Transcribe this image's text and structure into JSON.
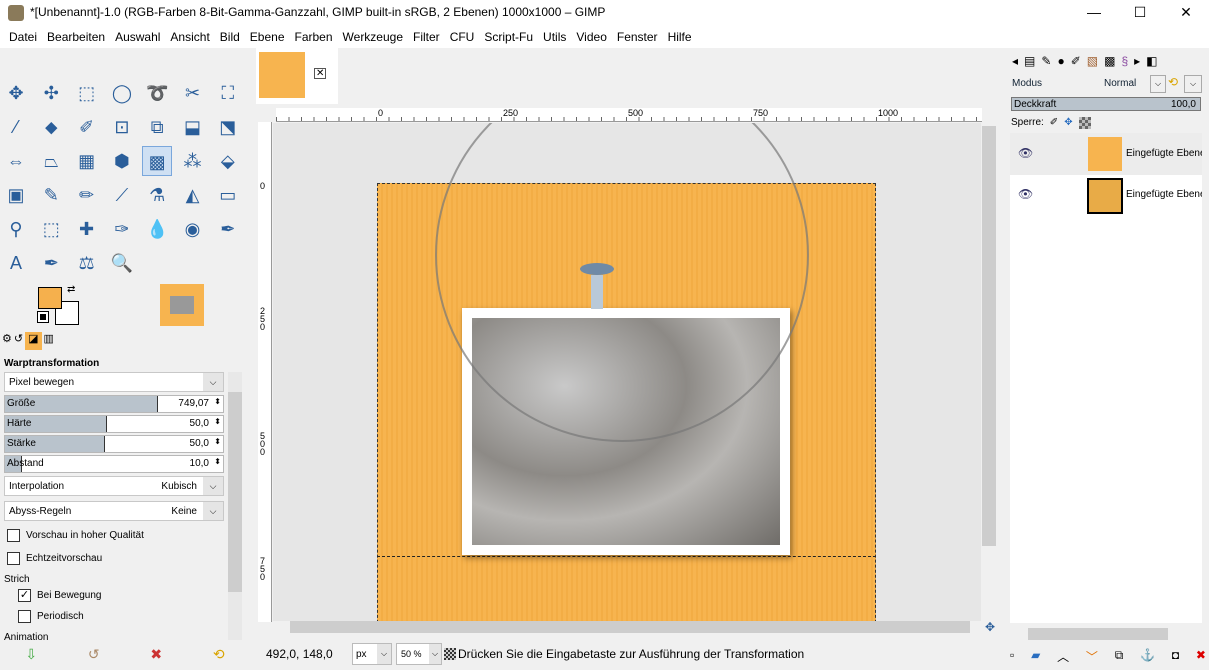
{
  "window": {
    "title": "*[Unbenannt]-1.0 (RGB-Farben 8-Bit-Gamma-Ganzzahl, GIMP built-in sRGB, 2 Ebenen) 1000x1000 – GIMP",
    "minimize": "—",
    "maximize": "☐",
    "close": "✕"
  },
  "menu": [
    "Datei",
    "Bearbeiten",
    "Auswahl",
    "Ansicht",
    "Bild",
    "Ebene",
    "Farben",
    "Werkzeuge",
    "Filter",
    "CFU",
    "Script-Fu",
    "Utils",
    "Video",
    "Fenster",
    "Hilfe"
  ],
  "tools": [
    "✥",
    "✣",
    "⬚",
    "◯",
    "➰",
    "✂",
    "⛶",
    "⁄",
    "⬥",
    "✐",
    "⊡",
    "⧉",
    "⬓",
    "⬔",
    "⇔",
    "⏢",
    "▦",
    "⬢",
    "▩",
    "⁂",
    "⬙",
    "▣",
    "✎",
    "✏",
    "⟋",
    "⚗",
    "◭",
    "▭",
    "⚲",
    "⬚",
    "✚",
    "✑",
    "💧",
    "◉",
    "✒",
    "A",
    "✒",
    "⚖",
    "🔍"
  ],
  "tool_options": {
    "title": "Warptransformation",
    "mode": "Pixel bewegen",
    "sliders": [
      {
        "label": "Größe",
        "value": "749,07",
        "fill": 0.7
      },
      {
        "label": "Härte",
        "value": "50,0",
        "fill": 0.47
      },
      {
        "label": "Stärke",
        "value": "50,0",
        "fill": 0.46
      },
      {
        "label": "Abstand",
        "value": "10,0",
        "fill": 0.08
      }
    ],
    "interpolation": {
      "label": "Interpolation",
      "value": "Kubisch"
    },
    "abyss": {
      "label": "Abyss-Regeln",
      "value": "Keine"
    },
    "checks": [
      {
        "label": "Vorschau in hoher Qualität",
        "checked": false
      },
      {
        "label": "Echtzeitvorschau",
        "checked": false
      }
    ],
    "stroke_label": "Strich",
    "stroke_checks": [
      {
        "label": "Bei Bewegung",
        "checked": true,
        "mark": "✓"
      },
      {
        "label": "Periodisch",
        "checked": false
      }
    ],
    "animation_label": "Animation"
  },
  "ruler": {
    "h": [
      "0",
      "250",
      "500",
      "750",
      "1000"
    ],
    "v": [
      "0",
      "250",
      "500",
      "750"
    ]
  },
  "status": {
    "coords": "492,0, 148,0",
    "unit": "px",
    "zoom": "50 %",
    "message": "Drücken Sie die Eingabetaste zur Ausführung der Transformation"
  },
  "layers_panel": {
    "mode_label": "Modus",
    "mode": "Normal",
    "opacity_label": "Deckkraft",
    "opacity": "100,0",
    "lock_label": "Sperre:",
    "layers": [
      {
        "name": "Eingefügte Ebene"
      },
      {
        "name": "Eingefügte Ebene"
      }
    ]
  },
  "colors": {
    "fg": "#f5b04d",
    "bg": "#ffffff",
    "canvas": "#f7b44f"
  }
}
